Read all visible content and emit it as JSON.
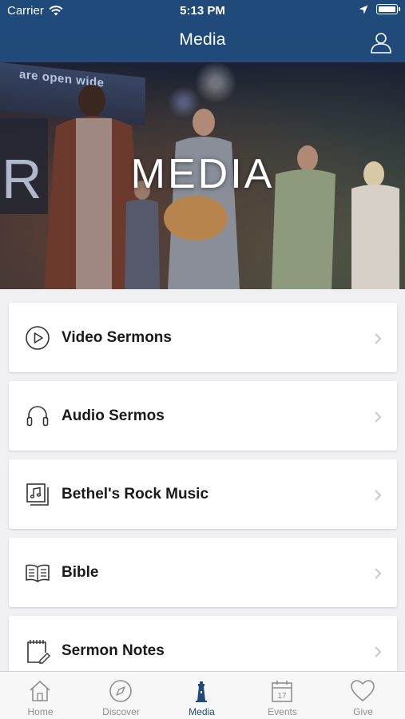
{
  "status_bar": {
    "carrier": "Carrier",
    "time": "5:13 PM"
  },
  "nav": {
    "title": "Media"
  },
  "hero": {
    "title": "MEDIA",
    "sign_text": "are open wide"
  },
  "menu": [
    {
      "label": "Video Sermons",
      "icon": "play-circle-icon"
    },
    {
      "label": "Audio Sermos",
      "icon": "headphones-icon"
    },
    {
      "label": "Bethel's Rock Music",
      "icon": "music-album-icon"
    },
    {
      "label": "Bible",
      "icon": "open-book-icon"
    },
    {
      "label": "Sermon Notes",
      "icon": "notepad-pencil-icon"
    }
  ],
  "tabs": [
    {
      "label": "Home",
      "icon": "home-icon",
      "active": false
    },
    {
      "label": "Discover",
      "icon": "compass-icon",
      "active": false
    },
    {
      "label": "Media",
      "icon": "lighthouse-icon",
      "active": true
    },
    {
      "label": "Events",
      "icon": "calendar-icon",
      "calendar_day": "17",
      "active": false
    },
    {
      "label": "Give",
      "icon": "heart-icon",
      "active": false
    }
  ],
  "colors": {
    "brand": "#1f4a7a",
    "tab_inactive": "#8f8f8f",
    "background": "#f0f0f2"
  }
}
